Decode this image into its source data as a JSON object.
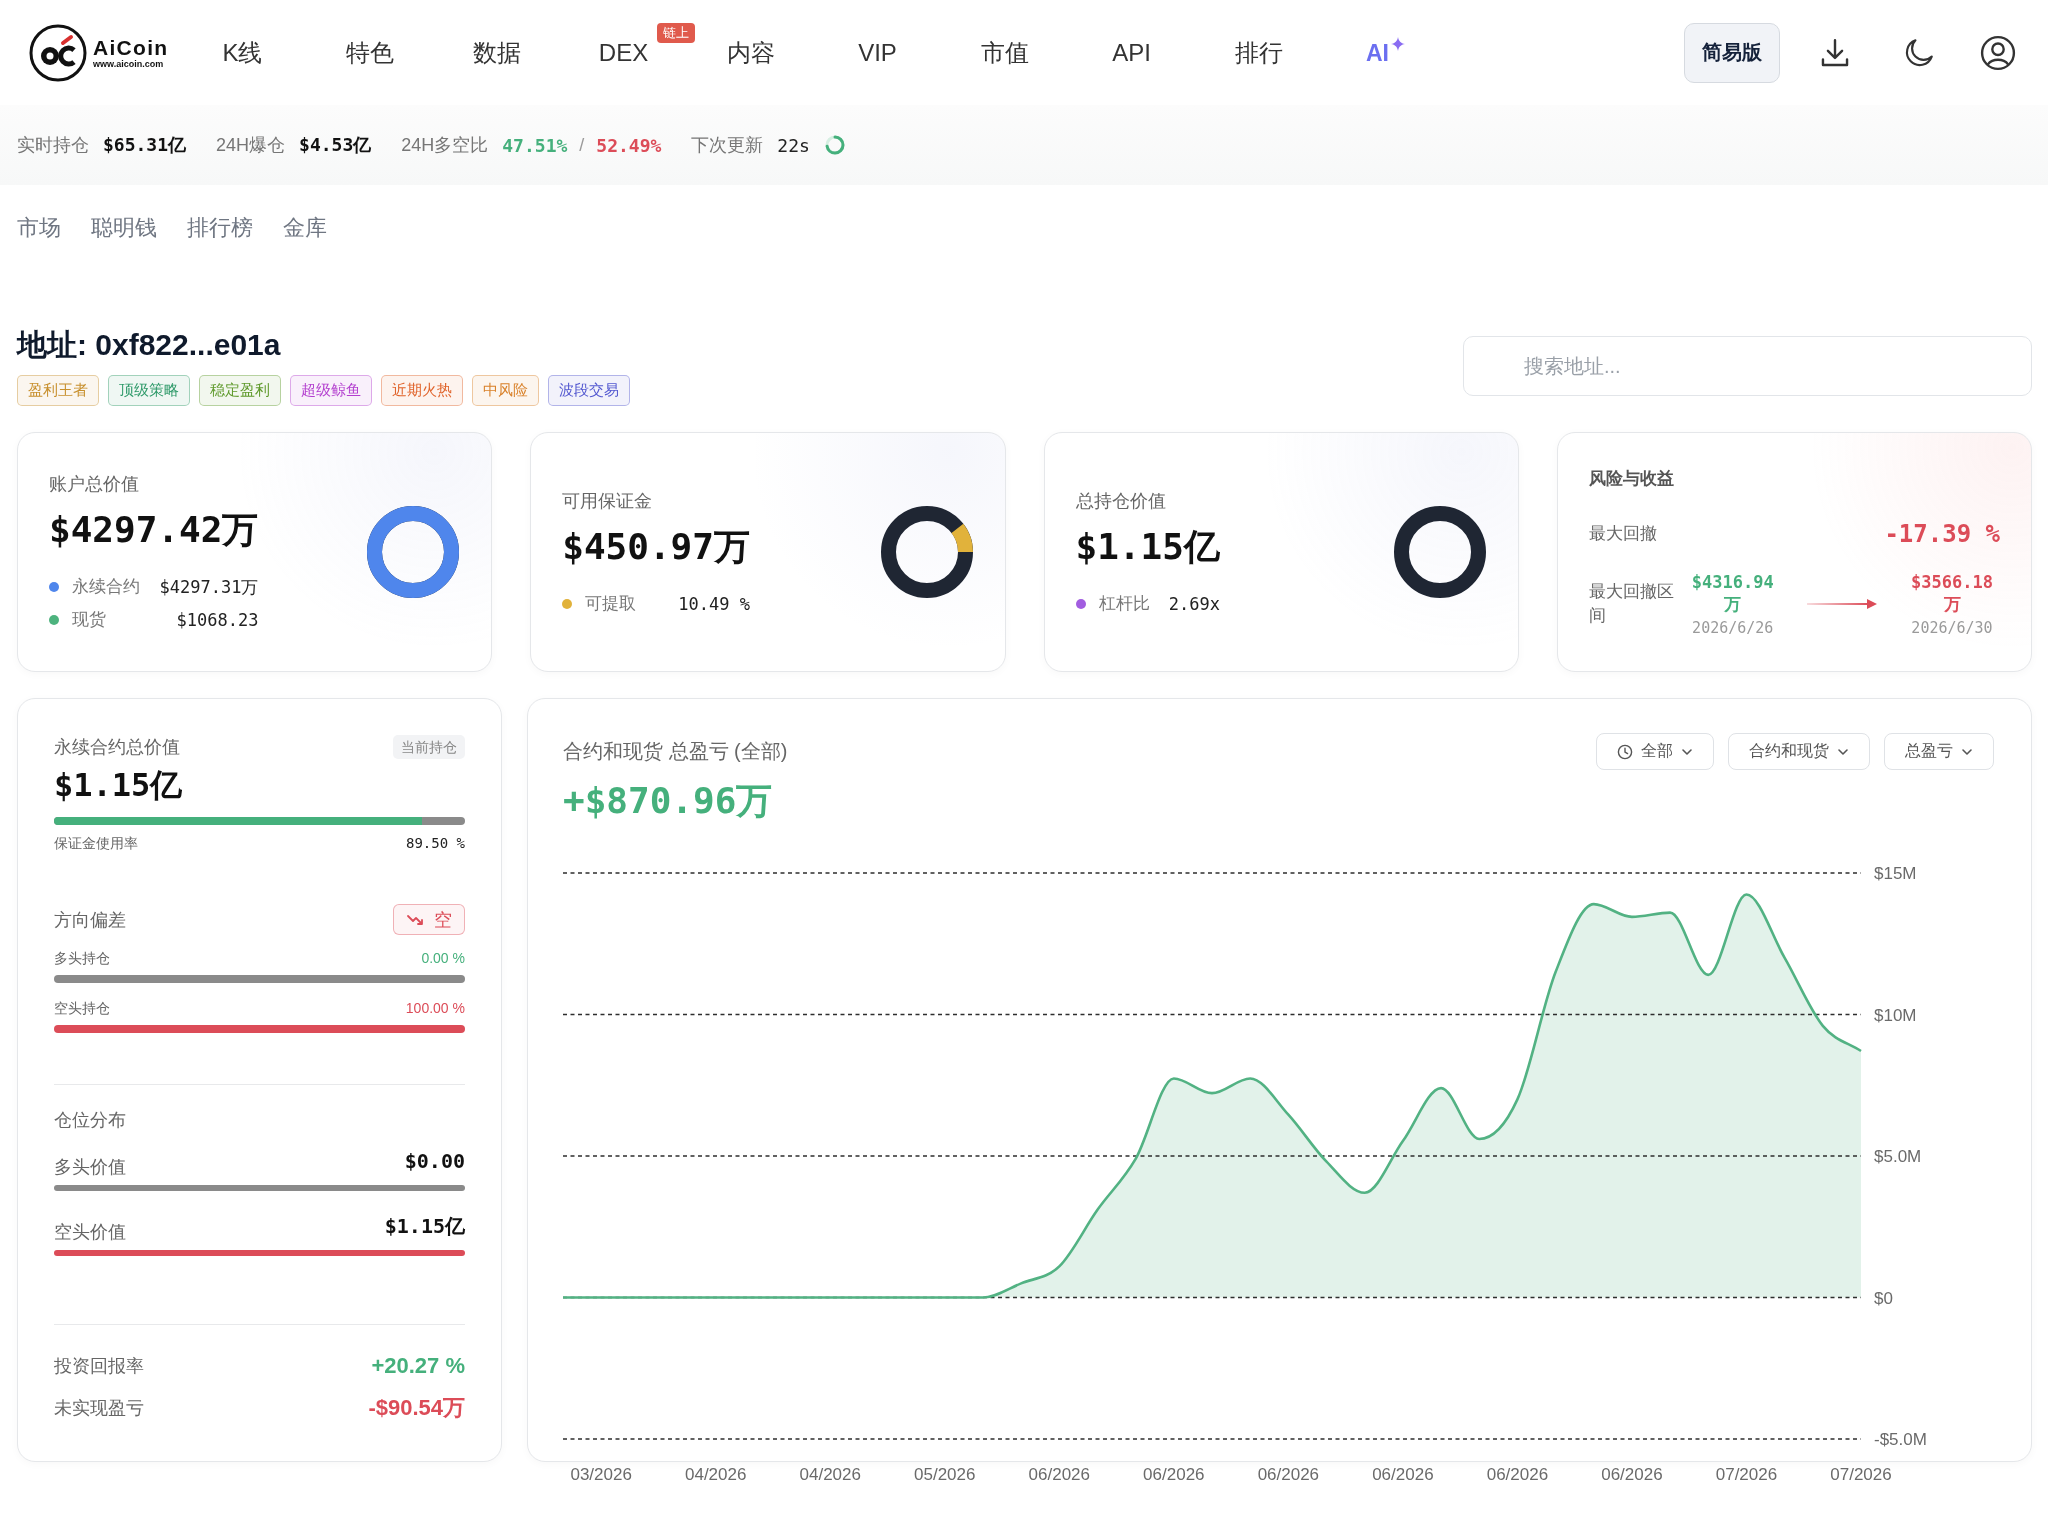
{
  "nav": {
    "logo": {
      "name": "AiCoin",
      "url": "www.aicoin.com"
    },
    "items": [
      {
        "label": "K线",
        "kind": "plain"
      },
      {
        "label": "特色",
        "kind": "plain"
      },
      {
        "label": "数据",
        "kind": "plain"
      },
      {
        "label": "DEX",
        "kind": "plain",
        "badge": "链上"
      },
      {
        "label": "内容",
        "kind": "plain"
      },
      {
        "label": "VIP",
        "kind": "plain"
      },
      {
        "label": "市值",
        "kind": "plain"
      },
      {
        "label": "API",
        "kind": "plain"
      },
      {
        "label": "排行",
        "kind": "plain"
      },
      {
        "label": "AI",
        "kind": "ai"
      }
    ],
    "mode_button": "简易版"
  },
  "stats": [
    {
      "kind": "value",
      "label": "实时持仓",
      "value": "$65.31亿"
    },
    {
      "kind": "value",
      "label": "24H爆仓",
      "value": "$4.53亿"
    },
    {
      "kind": "ratio",
      "label": "24H多空比",
      "long": "47.51%",
      "separator": "/",
      "short": "52.49%"
    },
    {
      "kind": "timer",
      "label": "下次更新",
      "value": "22s"
    }
  ],
  "subtabs": [
    "市场",
    "聪明钱",
    "排行榜",
    "金库"
  ],
  "address": {
    "title": "地址: 0xf822...e01a",
    "tags": [
      {
        "label": "盈利王者",
        "color": "#c8902e"
      },
      {
        "label": "顶级策略",
        "color": "#2f9a6a"
      },
      {
        "label": "稳定盈利",
        "color": "#5f9a2c"
      },
      {
        "label": "超级鲸鱼",
        "color": "#b33fcf"
      },
      {
        "label": "近期火热",
        "color": "#e0632a"
      },
      {
        "label": "中风险",
        "color": "#d9822b"
      },
      {
        "label": "波段交易",
        "color": "#5358d0"
      }
    ]
  },
  "search": {
    "placeholder": "搜索地址..."
  },
  "summary_cards": [
    {
      "kind": "balance",
      "title": "账户总价值",
      "value": "$4297.42万",
      "legend": [
        {
          "label": "永续合约",
          "value": "$4297.31万",
          "color": "#4f86ec",
          "fills_ring": true
        },
        {
          "label": "现货",
          "value": "$1068.23",
          "color": "#4db37e"
        }
      ]
    },
    {
      "kind": "balance",
      "title": "可用保证金",
      "value": "$450.97万",
      "legend": [
        {
          "label": "可提取",
          "value": "10.49 %",
          "color": "#e1b23b",
          "level": 0.1049
        }
      ]
    },
    {
      "kind": "balance",
      "title": "总持仓价值",
      "value": "$1.15亿",
      "legend": [
        {
          "label": "杠杆比",
          "value": "2.69x",
          "color": "#a25de0"
        }
      ]
    },
    {
      "kind": "risk",
      "title": "风险与收益",
      "drawdown": {
        "label": "最大回撤",
        "value": "-17.39 %"
      },
      "range": {
        "label": "最大回撤区间",
        "from": {
          "value": "$4316.94万",
          "date": "2026/6/26"
        },
        "to": {
          "value": "$3566.18万",
          "date": "2026/6/30"
        }
      }
    }
  ],
  "perpetual": {
    "title": "永续合约总价值",
    "badge": "当前持仓",
    "value": "$1.15亿",
    "margin_usage": {
      "label": "保证金使用率",
      "reading": "89.50 %",
      "level": 0.895
    },
    "direction": {
      "title": "方向偏差",
      "bias": {
        "kind": "short",
        "label": "空"
      },
      "rows": [
        {
          "kind": "long",
          "label": "多头持仓",
          "reading": "0.00 %",
          "level": 0
        },
        {
          "kind": "short",
          "label": "空头持仓",
          "reading": "100.00 %",
          "level": 1
        }
      ]
    },
    "distribution": {
      "title": "仓位分布",
      "rows": [
        {
          "kind": "long",
          "label": "多头价值",
          "value": "$0.00",
          "level": 0
        },
        {
          "kind": "short",
          "label": "空头价值",
          "value": "$1.15亿",
          "level": 1
        }
      ]
    },
    "metrics": [
      {
        "kind": "gain",
        "label": "投资回报率",
        "value": "+20.27 %"
      },
      {
        "kind": "loss",
        "label": "未实现盈亏",
        "value": "-$90.54万"
      }
    ]
  },
  "pnl": {
    "title": "合约和现货 总盈亏 (全部)",
    "total": "+$870.96万",
    "filters": [
      {
        "kind": "time",
        "label": "全部"
      },
      {
        "kind": "plain",
        "label": "合约和现货"
      },
      {
        "kind": "plain",
        "label": "总盈亏"
      }
    ],
    "chart_data": {
      "type": "area",
      "categories": [
        null,
        "03/2026",
        null,
        null,
        "04/2026",
        null,
        null,
        "04/2026",
        null,
        null,
        "05/2026",
        null,
        null,
        "06/2026",
        null,
        null,
        "06/2026",
        null,
        null,
        "06/2026",
        null,
        null,
        "06/2026",
        null,
        null,
        "06/2026",
        null,
        null,
        "06/2026",
        null,
        null,
        "07/2026",
        null,
        null,
        "07/2026"
      ],
      "series": [
        {
          "color": "#52b283",
          "values": [
            0,
            0,
            0,
            0,
            0,
            0,
            0,
            0,
            0,
            0,
            0,
            0,
            0.5,
            1.1,
            3.1,
            4.9,
            7.74,
            7.22,
            7.74,
            6.46,
            4.8,
            3.7,
            5.53,
            7.4,
            5.6,
            7.0,
            11.5,
            13.9,
            13.45,
            13.6,
            11.4,
            14.24,
            12.0,
            9.6,
            8.71
          ]
        }
      ],
      "ylim": [
        -5,
        15
      ],
      "yticks": [
        {
          "value": 15,
          "label": "$15M"
        },
        {
          "value": 10,
          "label": "$10M"
        },
        {
          "value": 5,
          "label": "$5.0M"
        },
        {
          "value": 0,
          "label": "$0"
        },
        {
          "value": -5,
          "label": "-$5.0M"
        }
      ],
      "grid": true
    }
  }
}
